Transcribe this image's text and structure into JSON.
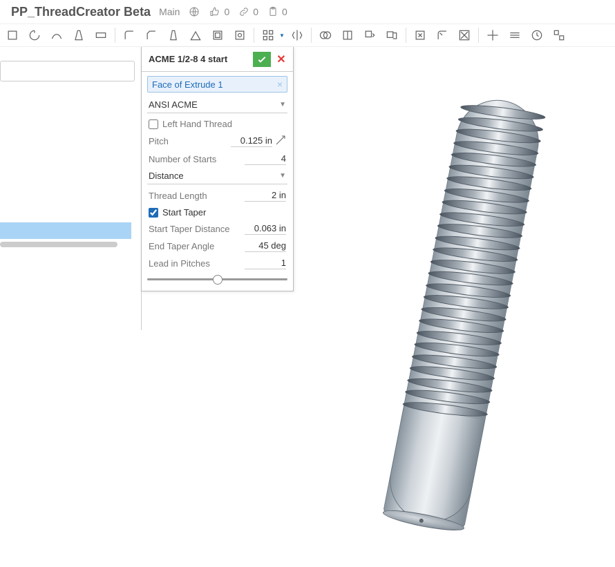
{
  "header": {
    "title": "PP_ThreadCreator Beta",
    "subtitle": "Main",
    "likes": "0",
    "links": "0",
    "clipboard": "0"
  },
  "dialog": {
    "title": "ACME 1/2-8 4 start",
    "face_chip": "Face of Extrude 1",
    "standard": "ANSI ACME",
    "left_hand_label": "Left Hand Thread",
    "pitch_label": "Pitch",
    "pitch_value": "0.125 in",
    "starts_label": "Number of Starts",
    "starts_value": "4",
    "end_type": "Distance",
    "length_label": "Thread Length",
    "length_value": "2 in",
    "start_taper_label": "Start Taper",
    "taper_dist_label": "Start Taper Distance",
    "taper_dist_value": "0.063 in",
    "taper_angle_label": "End Taper Angle",
    "taper_angle_value": "45 deg",
    "lead_label": "Lead in Pitches",
    "lead_value": "1"
  }
}
